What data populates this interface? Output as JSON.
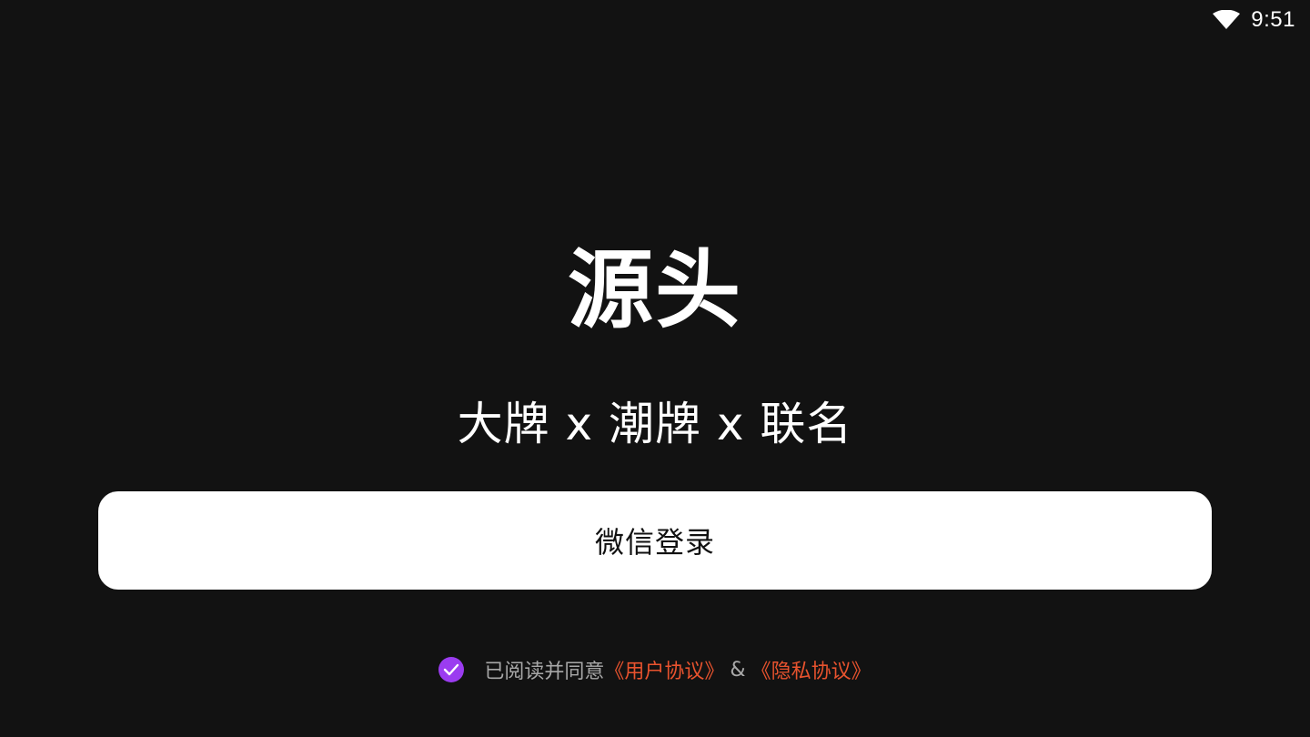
{
  "status_bar": {
    "time": "9:51",
    "wifi_icon": "wifi-icon"
  },
  "brand": {
    "logo_text": "源头",
    "tagline": "大牌 x 潮牌 x 联名"
  },
  "login": {
    "button_label": "微信登录"
  },
  "agreement": {
    "checked": true,
    "prefix": "已阅读并同意",
    "user_agreement": "《用户协议》",
    "separator": "&",
    "privacy_policy": "《隐私协议》"
  },
  "colors": {
    "background": "#121212",
    "button_bg": "#ffffff",
    "check_accent": "#9b3cf0",
    "link": "#e8532e"
  }
}
